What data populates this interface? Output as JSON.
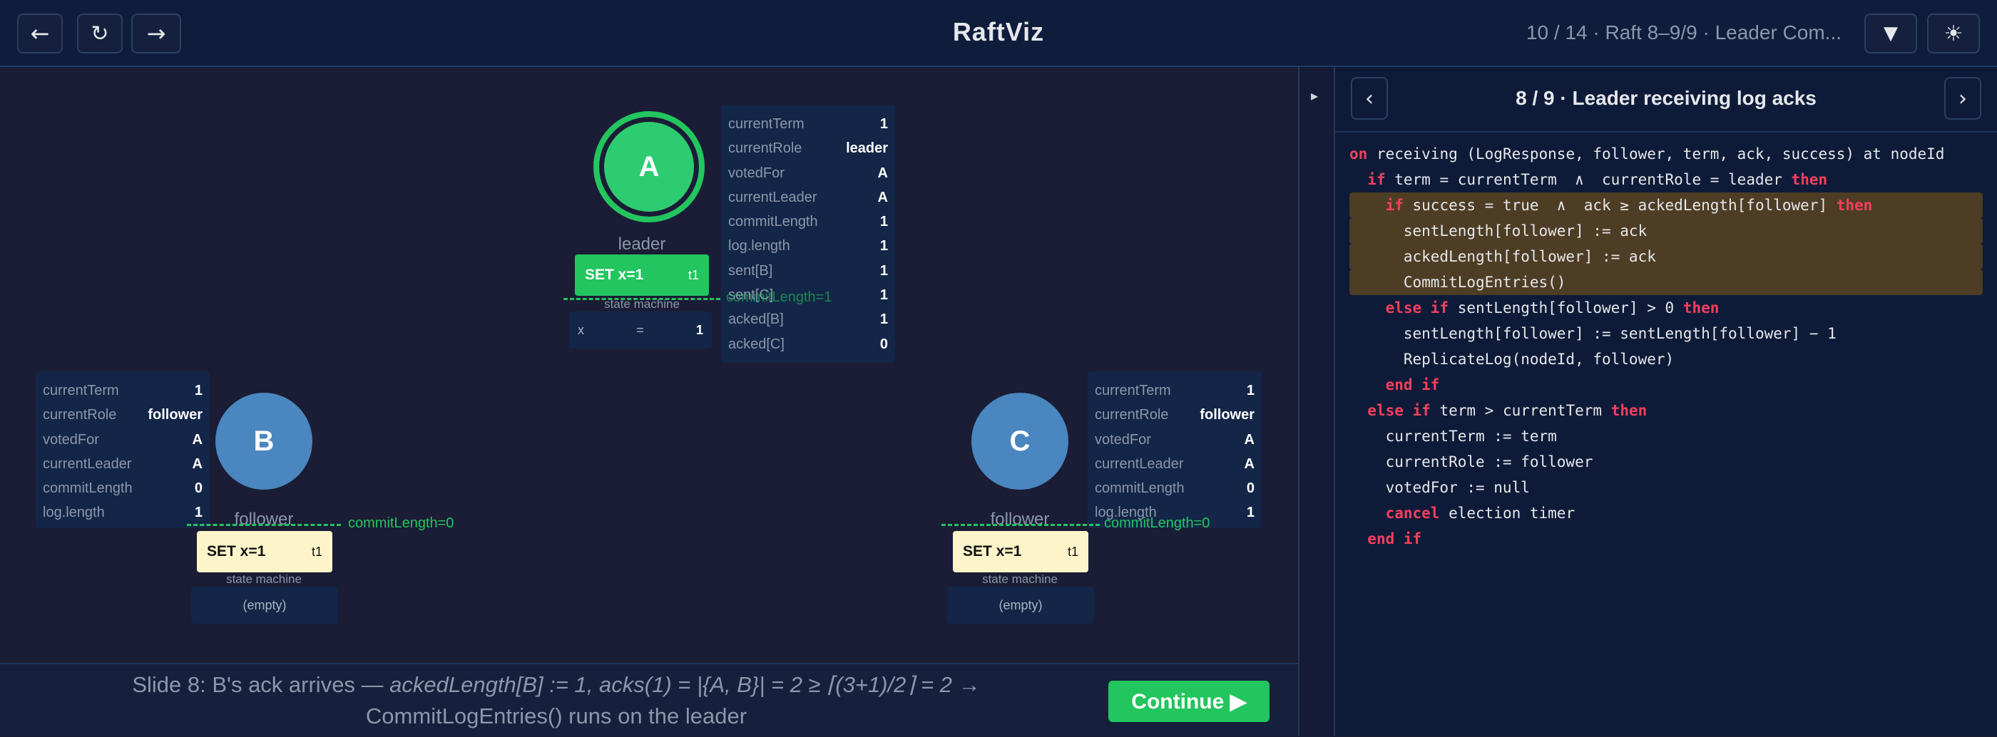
{
  "header": {
    "back_icon": "←",
    "reload_icon": "↻",
    "forward_icon": "→",
    "title": "RaftViz",
    "slide_info": "10 / 14 · Raft 8–9/9 · Leader Com...",
    "filter_icon": "▼",
    "theme_icon": "☀"
  },
  "panel": {
    "prev": "‹",
    "next": "›",
    "title": "8 / 9 · Leader receiving log acks",
    "toggle": "▸"
  },
  "nodes": {
    "A": {
      "name": "A",
      "role": "leader",
      "state": [
        {
          "k": "currentTerm",
          "v": "1"
        },
        {
          "k": "currentRole",
          "v": "leader"
        },
        {
          "k": "votedFor",
          "v": "A"
        },
        {
          "k": "currentLeader",
          "v": "A"
        },
        {
          "k": "commitLength",
          "v": "1"
        },
        {
          "k": "log.length",
          "v": "1"
        },
        {
          "k": "sent[B]",
          "v": "1"
        },
        {
          "k": "sent[C]",
          "v": "1"
        },
        {
          "k": "acked[B]",
          "v": "1"
        },
        {
          "k": "acked[C]",
          "v": "0"
        }
      ],
      "log_entry": "SET x=1",
      "log_term": "t1",
      "sm_label": "state machine",
      "sm_key": "x",
      "sm_eq": "=",
      "sm_val": "1",
      "commit_label": "commitLength=1"
    },
    "B": {
      "name": "B",
      "role": "follower",
      "state": [
        {
          "k": "currentTerm",
          "v": "1"
        },
        {
          "k": "currentRole",
          "v": "follower"
        },
        {
          "k": "votedFor",
          "v": "A"
        },
        {
          "k": "currentLeader",
          "v": "A"
        },
        {
          "k": "commitLength",
          "v": "0"
        },
        {
          "k": "log.length",
          "v": "1"
        }
      ],
      "log_entry": "SET x=1",
      "log_term": "t1",
      "sm_label": "state machine",
      "sm_value": "(empty)",
      "commit_label": "commitLength=0"
    },
    "C": {
      "name": "C",
      "role": "follower",
      "state": [
        {
          "k": "currentTerm",
          "v": "1"
        },
        {
          "k": "currentRole",
          "v": "follower"
        },
        {
          "k": "votedFor",
          "v": "A"
        },
        {
          "k": "currentLeader",
          "v": "A"
        },
        {
          "k": "commitLength",
          "v": "0"
        },
        {
          "k": "log.length",
          "v": "1"
        }
      ],
      "log_entry": "SET x=1",
      "log_term": "t1",
      "sm_label": "state machine",
      "sm_value": "(empty)",
      "commit_label": "commitLength=0"
    }
  },
  "caption": {
    "prefix": "Slide 8: B's ack arrives — ",
    "italic": "ackedLength[B] := 1, acks(1) = |{A, B}| = 2 ≥ ⌈(3+1)/2⌉ = 2",
    "suffix": " → CommitLogEntries() runs on the leader"
  },
  "continue_label": "Continue ▶",
  "code": [
    [
      {
        "t": "on",
        "kw": true
      },
      {
        "t": " receiving (LogResponse, follower, term, ack, success) at nodeId"
      }
    ],
    [
      {
        "t": "  "
      },
      {
        "t": "if",
        "kw": true
      },
      {
        "t": " term = currentTerm  ∧  currentRole = leader "
      },
      {
        "t": "then",
        "kw": true
      }
    ],
    [
      {
        "t": "    "
      },
      {
        "t": "if",
        "kw": true
      },
      {
        "t": " success = true  ∧  ack ≥ ackedLength[follower] "
      },
      {
        "t": "then",
        "kw": true
      }
    ],
    [
      {
        "t": "      sentLength[follower] := ack"
      }
    ],
    [
      {
        "t": "      ackedLength[follower] := ack"
      }
    ],
    [
      {
        "t": "      CommitLogEntries()"
      }
    ],
    [
      {
        "t": "    "
      },
      {
        "t": "else if",
        "kw": true
      },
      {
        "t": " sentLength[follower] > 0 "
      },
      {
        "t": "then",
        "kw": true
      }
    ],
    [
      {
        "t": "      sentLength[follower] := sentLength[follower] − 1"
      }
    ],
    [
      {
        "t": "      ReplicateLog(nodeId, follower)"
      }
    ],
    [
      {
        "t": "    "
      },
      {
        "t": "end if",
        "kw": true
      }
    ],
    [
      {
        "t": "  "
      },
      {
        "t": "else if",
        "kw": true
      },
      {
        "t": " term > currentTerm "
      },
      {
        "t": "then",
        "kw": true
      }
    ],
    [
      {
        "t": "    currentTerm := term"
      }
    ],
    [
      {
        "t": "    currentRole := follower"
      }
    ],
    [
      {
        "t": "    votedFor := null"
      }
    ],
    [
      {
        "t": "    "
      },
      {
        "t": "cancel",
        "kw": true
      },
      {
        "t": " election timer"
      }
    ],
    [
      {
        "t": "  "
      },
      {
        "t": "end if",
        "kw": true
      }
    ]
  ],
  "highlighted_lines": [
    2,
    3,
    4,
    5
  ],
  "colors": {
    "leader": "#22c55e",
    "follower": "#4a86bf",
    "log_follower": "#fdf5c9",
    "highlight": "#4e3d25",
    "keyword": "#f43f5e"
  }
}
